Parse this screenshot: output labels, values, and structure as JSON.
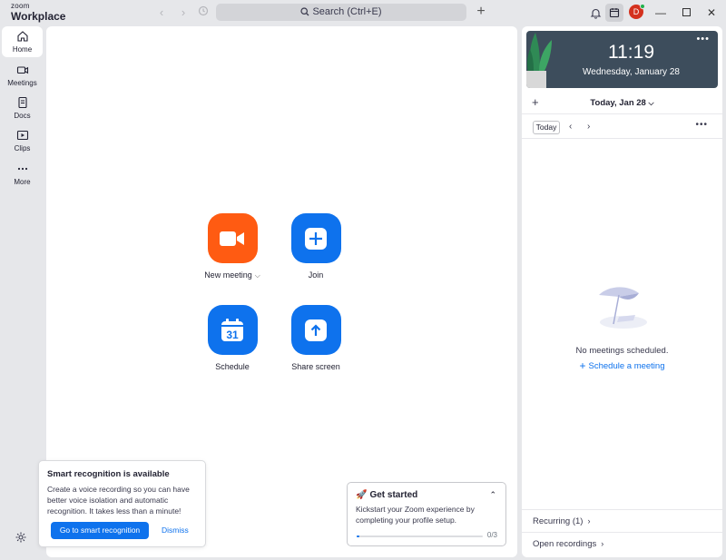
{
  "app": {
    "logo_top": "zoom",
    "logo_bottom": "Workplace"
  },
  "titlebar": {
    "search_label": "Search (Ctrl+E)",
    "avatar_initial": "D",
    "new_tab": "+"
  },
  "sidebar": {
    "items": [
      {
        "label": "Home",
        "icon": "home-icon",
        "active": true
      },
      {
        "label": "Meetings",
        "icon": "video-icon",
        "active": false
      },
      {
        "label": "Docs",
        "icon": "docs-icon",
        "active": false
      },
      {
        "label": "Clips",
        "icon": "clips-icon",
        "active": false
      },
      {
        "label": "More",
        "icon": "more-icon",
        "active": false
      }
    ]
  },
  "home": {
    "actions": {
      "new_meeting": "New meeting",
      "join": "Join",
      "schedule": "Schedule",
      "schedule_day": "31",
      "share_screen": "Share screen"
    }
  },
  "smart_popup": {
    "title": "Smart recognition is available",
    "body": "Create a voice recording so you can have better voice isolation and automatic recognition. It takes less than a minute!",
    "primary": "Go to smart recognition",
    "dismiss": "Dismiss"
  },
  "get_started": {
    "title": "Get started",
    "body": "Kickstart your Zoom experience by completing your profile setup.",
    "progress_count": "0/3",
    "progress_fraction": 0.02
  },
  "calendar": {
    "time": "11:19",
    "date": "Wednesday, January 28",
    "header": "Today, Jan 28",
    "today_button": "Today",
    "empty_text": "No meetings scheduled.",
    "schedule_link": "Schedule a meeting",
    "recurring": "Recurring (1)",
    "open_recordings": "Open recordings"
  },
  "colors": {
    "accent_blue": "#0e72ed",
    "accent_orange": "#ff5b12",
    "avatar_red": "#d4311e",
    "presence_green": "#22b14c"
  }
}
